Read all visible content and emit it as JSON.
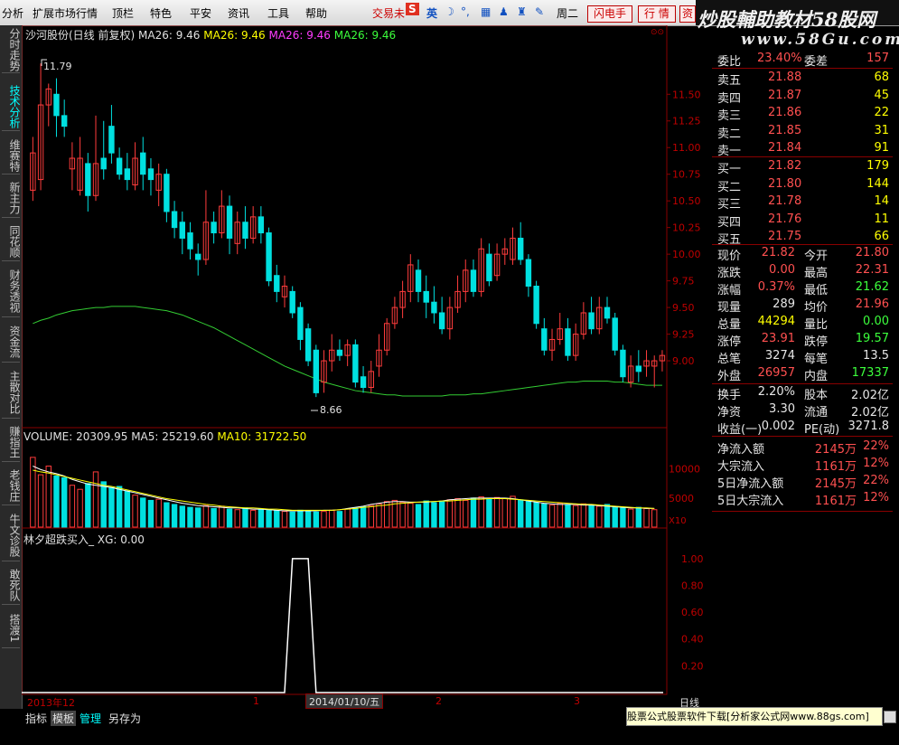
{
  "menu": [
    "分析",
    "扩展市场行情",
    "顶栏",
    "特色",
    "平安",
    "资讯",
    "工具",
    "帮助"
  ],
  "toolbar": {
    "trade_label": "交易未",
    "sogou_label": "S",
    "ime_label": "英",
    "date_partial": "周二",
    "flash_btn": "闪电手",
    "quote_btn": "行 情",
    "extra_btn": "资"
  },
  "watermark": {
    "title": "炒股輔助教材58股网",
    "url": "www.58Gu.com"
  },
  "sidebar_tabs": [
    "分时走势",
    "技术分析",
    "维赛特",
    "新主力",
    "同花顺",
    "财务透视",
    "资金流",
    "主散对比",
    "赚指王",
    "老钱庄",
    "牛文诊股",
    "敢死队",
    "搭渡1"
  ],
  "chart_header": {
    "name": "沙河股份(日线 前复权)",
    "ma1": "MA26: 9.46",
    "ma2": "MA26: 9.46",
    "ma3": "MA26: 9.46",
    "ma4": "MA26: 9.46"
  },
  "volume_header": {
    "volume": "VOLUME: 20309.95",
    "ma5": "MA5: 25219.60",
    "ma10": "MA10: 31722.50"
  },
  "indicator_header": {
    "name": "林夕超跌买入_",
    "xg": "XG: 0.00"
  },
  "price_axis": [
    "11.50",
    "11.25",
    "11.00",
    "10.75",
    "10.50",
    "10.25",
    "10.00",
    "9.75",
    "9.50",
    "9.25",
    "9.00"
  ],
  "volume_axis": [
    "10000",
    "5000",
    "X10"
  ],
  "indicator_axis": [
    "1.00",
    "0.80",
    "0.60",
    "0.40",
    "0.20"
  ],
  "annotations": {
    "high": "11.79",
    "low": "8.66"
  },
  "x_labels": {
    "start": "2013年12",
    "m1": "1",
    "m2": "2",
    "m3": "3",
    "cursor": "2014/01/10/五",
    "right": "日线"
  },
  "quotes": {
    "ratio": {
      "label1": "委比",
      "value1": "23.40%",
      "label2": "委差",
      "value2": "157"
    },
    "sell": [
      {
        "label": "卖五",
        "price": "21.88",
        "vol": "68"
      },
      {
        "label": "卖四",
        "price": "21.87",
        "vol": "45"
      },
      {
        "label": "卖三",
        "price": "21.86",
        "vol": "22"
      },
      {
        "label": "卖二",
        "price": "21.85",
        "vol": "31"
      },
      {
        "label": "卖一",
        "price": "21.84",
        "vol": "91"
      }
    ],
    "buy": [
      {
        "label": "买一",
        "price": "21.82",
        "vol": "179"
      },
      {
        "label": "买二",
        "price": "21.80",
        "vol": "144"
      },
      {
        "label": "买三",
        "price": "21.78",
        "vol": "14"
      },
      {
        "label": "买四",
        "price": "21.76",
        "vol": "11"
      },
      {
        "label": "买五",
        "price": "21.75",
        "vol": "66"
      }
    ],
    "stats": [
      {
        "l1": "现价",
        "v1": "21.82",
        "c1": "red",
        "l2": "今开",
        "v2": "21.80",
        "c2": "red"
      },
      {
        "l1": "涨跌",
        "v1": "0.00",
        "c1": "red",
        "l2": "最高",
        "v2": "22.31",
        "c2": "red"
      },
      {
        "l1": "涨幅",
        "v1": "0.37%",
        "c1": "red",
        "l2": "最低",
        "v2": "21.62",
        "c2": "green"
      },
      {
        "l1": "现量",
        "v1": "289",
        "c1": "white",
        "l2": "均价",
        "v2": "21.96",
        "c2": "red"
      },
      {
        "l1": "总量",
        "v1": "44294",
        "c1": "yellow",
        "l2": "量比",
        "v2": "0.00",
        "c2": "green"
      },
      {
        "l1": "涨停",
        "v1": "23.91",
        "c1": "red",
        "l2": "跌停",
        "v2": "19.57",
        "c2": "green"
      },
      {
        "l1": "总笔",
        "v1": "3274",
        "c1": "white",
        "l2": "每笔",
        "v2": "13.5",
        "c2": "white"
      },
      {
        "l1": "外盘",
        "v1": "26957",
        "c1": "red",
        "l2": "内盘",
        "v2": "17337",
        "c2": "green"
      }
    ],
    "fin": [
      {
        "l1": "换手",
        "v1": "2.20%",
        "l2": "股本",
        "v2": "2.02亿"
      },
      {
        "l1": "净资",
        "v1": "3.30",
        "l2": "流通",
        "v2": "2.02亿"
      },
      {
        "l1": "收益(一)",
        "v1": "0.002",
        "l2": "PE(动)",
        "v2": "3271.8"
      }
    ],
    "flow": [
      {
        "label": "净流入额",
        "value": "2145万",
        "pct": "22%"
      },
      {
        "label": "大宗流入",
        "value": "1161万",
        "pct": "12%"
      },
      {
        "label": "5日净流入额",
        "value": "2145万",
        "pct": "22%"
      },
      {
        "label": "5日大宗流入",
        "value": "1161万",
        "pct": "12%"
      }
    ]
  },
  "bottom_tabs": [
    "指标",
    "模板",
    "管理",
    "另存为"
  ],
  "ad_text": "股票公式股票软件下载[分析家公式网www.88gs.com]",
  "colors": {
    "up": "#ff3c3c",
    "down": "#00e0e0",
    "ma": "#33cc33",
    "grid": "#8a0000"
  },
  "chart_data": {
    "type": "candlestick",
    "price_range": [
      8.5,
      11.85
    ],
    "candles": [
      {
        "o": 10.6,
        "c": 10.95,
        "h": 11.1,
        "l": 10.5
      },
      {
        "o": 10.7,
        "c": 11.4,
        "h": 11.79,
        "l": 10.6
      },
      {
        "o": 11.4,
        "c": 11.55,
        "h": 11.6,
        "l": 11.2
      },
      {
        "o": 11.5,
        "c": 11.3,
        "h": 11.65,
        "l": 11.1
      },
      {
        "o": 11.3,
        "c": 11.2,
        "h": 11.45,
        "l": 11.1
      },
      {
        "o": 10.8,
        "c": 10.9,
        "h": 11.05,
        "l": 10.6
      },
      {
        "o": 10.6,
        "c": 10.9,
        "h": 11.1,
        "l": 10.55
      },
      {
        "o": 10.85,
        "c": 10.55,
        "h": 10.95,
        "l": 10.4
      },
      {
        "o": 10.55,
        "c": 10.85,
        "h": 11.3,
        "l": 10.5
      },
      {
        "o": 10.9,
        "c": 10.8,
        "h": 11.25,
        "l": 10.7
      },
      {
        "o": 11.2,
        "c": 10.95,
        "h": 11.4,
        "l": 10.85
      },
      {
        "o": 10.9,
        "c": 10.75,
        "h": 11.0,
        "l": 10.7
      },
      {
        "o": 10.8,
        "c": 10.7,
        "h": 10.95,
        "l": 10.6
      },
      {
        "o": 10.65,
        "c": 10.9,
        "h": 11.05,
        "l": 10.6
      },
      {
        "o": 10.95,
        "c": 10.75,
        "h": 11.1,
        "l": 10.6
      },
      {
        "o": 10.8,
        "c": 10.7,
        "h": 10.9,
        "l": 10.55
      },
      {
        "o": 10.6,
        "c": 10.75,
        "h": 10.85,
        "l": 10.45
      },
      {
        "o": 10.75,
        "c": 10.4,
        "h": 10.8,
        "l": 10.3
      },
      {
        "o": 10.4,
        "c": 10.25,
        "h": 10.5,
        "l": 10.15
      },
      {
        "o": 10.3,
        "c": 10.15,
        "h": 10.4,
        "l": 10.0
      },
      {
        "o": 10.2,
        "c": 10.05,
        "h": 10.3,
        "l": 9.95
      },
      {
        "o": 10.0,
        "c": 9.95,
        "h": 10.1,
        "l": 9.8
      },
      {
        "o": 9.95,
        "c": 10.3,
        "h": 10.6,
        "l": 9.9
      },
      {
        "o": 10.3,
        "c": 10.2,
        "h": 10.4,
        "l": 10.1
      },
      {
        "o": 10.2,
        "c": 10.45,
        "h": 10.6,
        "l": 10.15
      },
      {
        "o": 10.45,
        "c": 10.15,
        "h": 10.55,
        "l": 10.0
      },
      {
        "o": 10.1,
        "c": 10.3,
        "h": 10.4,
        "l": 10.0
      },
      {
        "o": 10.3,
        "c": 10.15,
        "h": 10.45,
        "l": 10.05
      },
      {
        "o": 10.15,
        "c": 10.35,
        "h": 10.45,
        "l": 10.1
      },
      {
        "o": 10.35,
        "c": 10.2,
        "h": 10.45,
        "l": 10.1
      },
      {
        "o": 10.2,
        "c": 9.75,
        "h": 10.25,
        "l": 9.7
      },
      {
        "o": 9.8,
        "c": 9.65,
        "h": 9.9,
        "l": 9.55
      },
      {
        "o": 9.6,
        "c": 9.7,
        "h": 9.8,
        "l": 9.5
      },
      {
        "o": 9.65,
        "c": 9.45,
        "h": 9.7,
        "l": 9.4
      },
      {
        "o": 9.5,
        "c": 9.2,
        "h": 9.55,
        "l": 9.1
      },
      {
        "o": 9.3,
        "c": 9.0,
        "h": 9.35,
        "l": 8.95
      },
      {
        "o": 9.1,
        "c": 8.7,
        "h": 9.15,
        "l": 8.66
      },
      {
        "o": 8.8,
        "c": 9.0,
        "h": 9.1,
        "l": 8.7
      },
      {
        "o": 9.0,
        "c": 9.1,
        "h": 9.25,
        "l": 8.9
      },
      {
        "o": 9.1,
        "c": 9.05,
        "h": 9.2,
        "l": 9.0
      },
      {
        "o": 9.05,
        "c": 9.15,
        "h": 9.2,
        "l": 8.95
      },
      {
        "o": 9.15,
        "c": 8.8,
        "h": 9.2,
        "l": 8.75
      },
      {
        "o": 8.85,
        "c": 8.75,
        "h": 8.95,
        "l": 8.7
      },
      {
        "o": 8.75,
        "c": 8.9,
        "h": 9.0,
        "l": 8.7
      },
      {
        "o": 8.95,
        "c": 9.1,
        "h": 9.25,
        "l": 8.85
      },
      {
        "o": 9.1,
        "c": 9.35,
        "h": 9.4,
        "l": 9.05
      },
      {
        "o": 9.35,
        "c": 9.5,
        "h": 9.6,
        "l": 9.3
      },
      {
        "o": 9.5,
        "c": 9.65,
        "h": 9.75,
        "l": 9.4
      },
      {
        "o": 9.65,
        "c": 9.9,
        "h": 10.0,
        "l": 9.55
      },
      {
        "o": 9.85,
        "c": 9.65,
        "h": 9.95,
        "l": 9.55
      },
      {
        "o": 9.65,
        "c": 9.55,
        "h": 9.8,
        "l": 9.4
      },
      {
        "o": 9.55,
        "c": 9.45,
        "h": 9.7,
        "l": 9.35
      },
      {
        "o": 9.45,
        "c": 9.3,
        "h": 9.6,
        "l": 9.25
      },
      {
        "o": 9.3,
        "c": 9.5,
        "h": 9.6,
        "l": 9.2
      },
      {
        "o": 9.5,
        "c": 9.65,
        "h": 9.8,
        "l": 9.45
      },
      {
        "o": 9.65,
        "c": 9.85,
        "h": 9.95,
        "l": 9.55
      },
      {
        "o": 9.85,
        "c": 9.65,
        "h": 9.95,
        "l": 9.6
      },
      {
        "o": 9.65,
        "c": 10.05,
        "h": 10.15,
        "l": 9.6
      },
      {
        "o": 10.0,
        "c": 9.75,
        "h": 10.1,
        "l": 9.7
      },
      {
        "o": 9.8,
        "c": 10.0,
        "h": 10.1,
        "l": 9.75
      },
      {
        "o": 10.0,
        "c": 10.05,
        "h": 10.15,
        "l": 9.9
      },
      {
        "o": 9.95,
        "c": 10.15,
        "h": 10.25,
        "l": 9.9
      },
      {
        "o": 10.15,
        "c": 9.95,
        "h": 10.3,
        "l": 9.9
      },
      {
        "o": 9.95,
        "c": 9.7,
        "h": 10.0,
        "l": 9.6
      },
      {
        "o": 9.7,
        "c": 9.35,
        "h": 9.75,
        "l": 9.3
      },
      {
        "o": 9.3,
        "c": 9.1,
        "h": 9.4,
        "l": 9.05
      },
      {
        "o": 9.1,
        "c": 9.2,
        "h": 9.3,
        "l": 9.0
      },
      {
        "o": 9.2,
        "c": 9.3,
        "h": 9.45,
        "l": 9.15
      },
      {
        "o": 9.3,
        "c": 9.05,
        "h": 9.4,
        "l": 9.0
      },
      {
        "o": 9.05,
        "c": 9.25,
        "h": 9.35,
        "l": 9.0
      },
      {
        "o": 9.25,
        "c": 9.45,
        "h": 9.55,
        "l": 9.2
      },
      {
        "o": 9.45,
        "c": 9.3,
        "h": 9.6,
        "l": 9.25
      },
      {
        "o": 9.3,
        "c": 9.5,
        "h": 9.6,
        "l": 9.25
      },
      {
        "o": 9.5,
        "c": 9.4,
        "h": 9.6,
        "l": 9.35
      },
      {
        "o": 9.4,
        "c": 9.1,
        "h": 9.45,
        "l": 9.05
      },
      {
        "o": 9.1,
        "c": 8.85,
        "h": 9.15,
        "l": 8.8
      },
      {
        "o": 8.8,
        "c": 8.95,
        "h": 9.05,
        "l": 8.75
      },
      {
        "o": 8.95,
        "c": 8.9,
        "h": 9.1,
        "l": 8.8
      },
      {
        "o": 8.95,
        "c": 9.0,
        "h": 9.1,
        "l": 8.85
      },
      {
        "o": 8.95,
        "c": 9.0,
        "h": 9.05,
        "l": 8.75
      },
      {
        "o": 9.0,
        "c": 9.05,
        "h": 9.1,
        "l": 8.9
      }
    ],
    "ma": [
      9.35,
      9.38,
      9.4,
      9.43,
      9.45,
      9.47,
      9.48,
      9.49,
      9.5,
      9.5,
      9.51,
      9.51,
      9.51,
      9.51,
      9.5,
      9.49,
      9.48,
      9.47,
      9.45,
      9.43,
      9.4,
      9.37,
      9.34,
      9.31,
      9.27,
      9.23,
      9.19,
      9.15,
      9.11,
      9.07,
      9.03,
      8.99,
      8.95,
      8.92,
      8.89,
      8.86,
      8.83,
      8.8,
      8.78,
      8.76,
      8.74,
      8.72,
      8.71,
      8.7,
      8.69,
      8.68,
      8.68,
      8.67,
      8.67,
      8.67,
      8.67,
      8.67,
      8.67,
      8.68,
      8.68,
      8.68,
      8.69,
      8.69,
      8.7,
      8.71,
      8.72,
      8.73,
      8.74,
      8.75,
      8.76,
      8.77,
      8.78,
      8.79,
      8.8,
      8.8,
      8.81,
      8.81,
      8.81,
      8.81,
      8.8,
      8.8,
      8.79,
      8.78,
      8.77,
      8.77,
      8.77
    ],
    "volume_range": [
      0,
      14000
    ],
    "volume": [
      12000,
      9000,
      10500,
      8800,
      8500,
      7200,
      6500,
      7500,
      9500,
      7800,
      6800,
      7000,
      6200,
      5500,
      5000,
      4600,
      4800,
      4200,
      3900,
      3600,
      3400,
      3300,
      3700,
      3200,
      3600,
      3100,
      3000,
      3300,
      2900,
      3100,
      3000,
      2800,
      2700,
      2600,
      2900,
      2800,
      2600,
      2700,
      2900,
      2700,
      3100,
      3300,
      3500,
      3700,
      4000,
      4400,
      4600,
      4300,
      4100,
      3900,
      4500,
      4200,
      4400,
      4700,
      4900,
      4600,
      5000,
      5200,
      4800,
      5100,
      4900,
      5300,
      4700,
      4500,
      4200,
      4000,
      3800,
      4100,
      3900,
      3700,
      4000,
      3800,
      3600,
      3900,
      3500,
      3300,
      3100,
      3400,
      3200,
      3000
    ],
    "volume_ma5": [
      10500,
      9900,
      9500,
      9200,
      8800,
      8200,
      7800,
      7400,
      7200,
      7000,
      6800,
      6500,
      6200,
      5900,
      5600,
      5300,
      5000,
      4700,
      4400,
      4100,
      3900,
      3700,
      3600,
      3500,
      3400,
      3300,
      3300,
      3200,
      3100,
      3100,
      3000,
      2900,
      2800,
      2800,
      2800,
      2800,
      2800,
      2900,
      2900,
      3000,
      3200,
      3400,
      3600,
      3900,
      4100,
      4300,
      4400,
      4400,
      4300,
      4300,
      4300,
      4400,
      4500,
      4700,
      4800,
      4900,
      5000,
      5000,
      5000,
      5000,
      5000,
      4900,
      4700,
      4500,
      4300,
      4100,
      4000,
      3900,
      3900,
      3900,
      3800,
      3800,
      3700,
      3600,
      3500,
      3400,
      3300,
      3300,
      3200,
      3200
    ],
    "volume_ma10": [
      9800,
      9500,
      9300,
      9000,
      8700,
      8400,
      8100,
      7800,
      7500,
      7200,
      7000,
      6700,
      6400,
      6100,
      5800,
      5500,
      5200,
      4900,
      4700,
      4500,
      4300,
      4100,
      3900,
      3800,
      3600,
      3500,
      3400,
      3300,
      3300,
      3200,
      3100,
      3100,
      3000,
      2900,
      2900,
      2900,
      2900,
      2900,
      2900,
      3000,
      3100,
      3200,
      3400,
      3500,
      3700,
      3800,
      4000,
      4100,
      4200,
      4300,
      4400,
      4400,
      4500,
      4500,
      4600,
      4700,
      4800,
      4800,
      4900,
      4900,
      4900,
      4800,
      4700,
      4600,
      4500,
      4400,
      4300,
      4200,
      4100,
      4000,
      3900,
      3900,
      3800,
      3700,
      3600,
      3500,
      3400,
      3300,
      3300,
      3200
    ],
    "indicator_range": [
      0,
      1.1
    ],
    "indicator_xg_spike": {
      "start_index": 33,
      "end_index": 36,
      "value": 1.0
    }
  }
}
